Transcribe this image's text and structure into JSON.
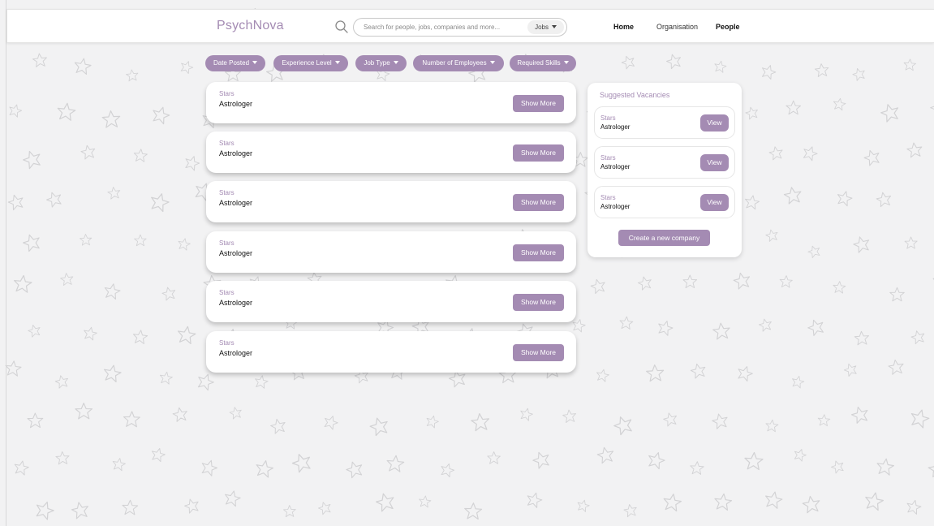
{
  "header": {
    "logo": "PsychNova",
    "search_placeholder": "Search for people, jobs, companies and more...",
    "search_scope": "Jobs",
    "nav": {
      "home": "Home",
      "organisation": "Organisation",
      "people": "People"
    }
  },
  "filters": [
    "Date Posted",
    "Experience Level",
    "Job Type",
    "Number of Employees",
    "Required Skills"
  ],
  "jobs": [
    {
      "company": "Stars",
      "title": "Astrologer",
      "action": "Show More"
    },
    {
      "company": "Stars",
      "title": "Astrologer",
      "action": "Show More"
    },
    {
      "company": "Stars",
      "title": "Astrologer",
      "action": "Show More"
    },
    {
      "company": "Stars",
      "title": "Astrologer",
      "action": "Show More"
    },
    {
      "company": "Stars",
      "title": "Astrologer",
      "action": "Show More"
    },
    {
      "company": "Stars",
      "title": "Astrologer",
      "action": "Show More"
    }
  ],
  "suggested": {
    "title": "Suggested Vacancies",
    "items": [
      {
        "company": "Stars",
        "title": "Astrologer",
        "action": "View"
      },
      {
        "company": "Stars",
        "title": "Astrologer",
        "action": "View"
      },
      {
        "company": "Stars",
        "title": "Astrologer",
        "action": "View"
      }
    ],
    "create_label": "Create a new company"
  },
  "theme": {
    "accent": "#a48bb3",
    "background": "#f2f2f3"
  }
}
